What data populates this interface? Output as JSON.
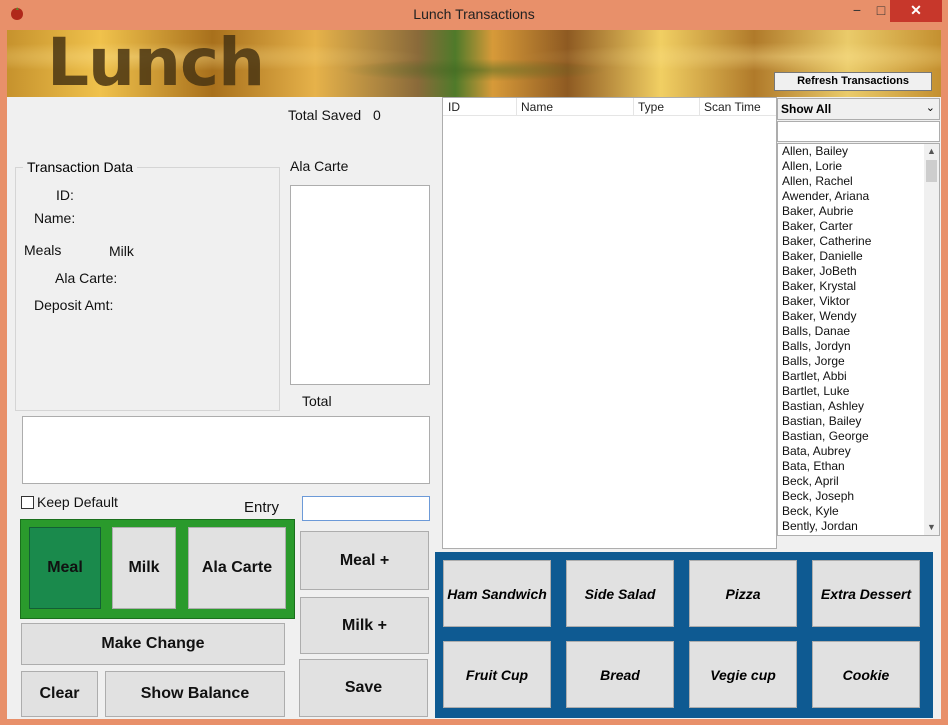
{
  "window": {
    "title": "Lunch Transactions"
  },
  "banner": {
    "title": "Lunch",
    "refresh_label": "Refresh Transactions"
  },
  "summary": {
    "total_saved_label": "Total Saved",
    "total_saved_value": "0"
  },
  "transaction": {
    "group_title": "Transaction Data",
    "id_label": "ID:",
    "name_label": "Name:",
    "meals_label": "Meals",
    "milk_label": "Milk",
    "ala_carte_label": "Ala Carte:",
    "deposit_label": "Deposit Amt:"
  },
  "ala_carte": {
    "label": "Ala Carte",
    "total_label": "Total"
  },
  "entry": {
    "keep_default_label": "Keep Default",
    "entry_label": "Entry",
    "entry_value": ""
  },
  "buttons": {
    "meal": "Meal",
    "milk": "Milk",
    "ala_carte": "Ala Carte",
    "meal_plus": "Meal +",
    "milk_plus": "Milk +",
    "make_change": "Make Change",
    "clear": "Clear",
    "show_balance": "Show Balance",
    "save": "Save"
  },
  "transactions_table": {
    "columns": [
      "ID",
      "Name",
      "Type",
      "Scan Time"
    ],
    "rows": []
  },
  "filter": {
    "selected": "Show All",
    "search_value": ""
  },
  "students": [
    "Allen, Bailey",
    "Allen, Lorie",
    "Allen, Rachel",
    "Awender, Ariana",
    "Baker, Aubrie",
    "Baker, Carter",
    "Baker, Catherine",
    "Baker, Danielle",
    "Baker, JoBeth",
    "Baker, Krystal",
    "Baker, Viktor",
    "Baker, Wendy",
    "Balls, Danae",
    "Balls, Jordyn",
    "Balls, Jorge",
    "Bartlet, Abbi",
    "Bartlet, Luke",
    "Bastian, Ashley",
    "Bastian, Bailey",
    "Bastian, George",
    "Bata, Aubrey",
    "Bata, Ethan",
    "Beck, April",
    "Beck, Joseph",
    "Beck, Kyle",
    "Bently, Jordan"
  ],
  "ala_carte_items": [
    "Ham Sandwich",
    "Side Salad",
    "Pizza",
    "Extra Dessert",
    "Fruit Cup",
    "Bread",
    "Vegie cup",
    "Cookie"
  ],
  "colors": {
    "titlebar": "#e8906a",
    "meal_selected": "#1a8a4c",
    "green_panel": "#2a9a2c",
    "blue_panel": "#0e5a92",
    "close_button": "#c7372b"
  }
}
